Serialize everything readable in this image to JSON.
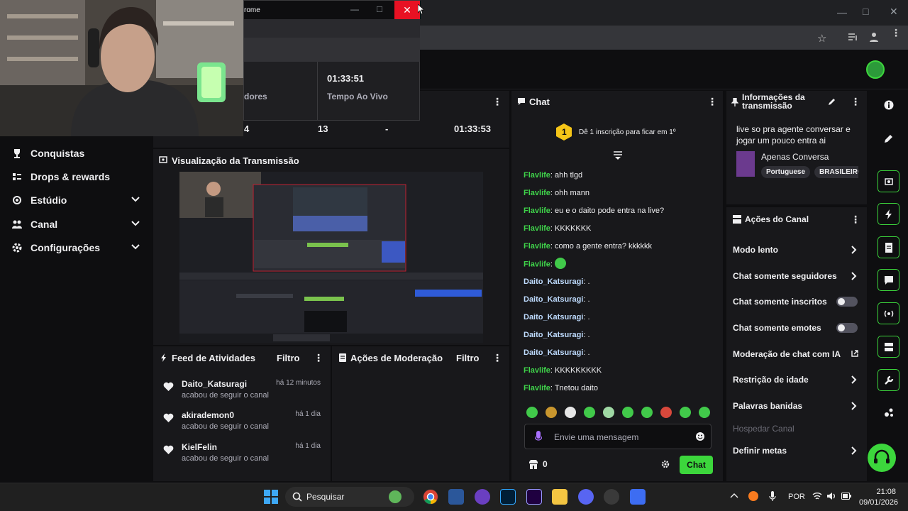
{
  "window": {
    "title_fragment": "rome"
  },
  "popup": {
    "time_value": "01:33:51",
    "time_label": "Tempo Ao Vivo",
    "left_label": "dores"
  },
  "stats": {
    "values": [
      "4",
      "13",
      "-",
      "01:33:53"
    ]
  },
  "nav": {
    "items": [
      {
        "label": "Conquistas",
        "icon": "trophy-icon",
        "chevron": false
      },
      {
        "label": "Drops & rewards",
        "icon": "drops-icon",
        "chevron": false
      },
      {
        "label": "Estúdio",
        "icon": "studio-icon",
        "chevron": true
      },
      {
        "label": "Canal",
        "icon": "channel-icon",
        "chevron": true
      },
      {
        "label": "Configurações",
        "icon": "gear-icon",
        "chevron": true
      }
    ]
  },
  "preview": {
    "title": "Visualização da Transmissão"
  },
  "feed": {
    "title": "Feed de Atividades",
    "filter": "Filtro",
    "items": [
      {
        "name": "Daito_Katsuragi",
        "sub": "acabou de seguir o canal",
        "time": "há 12 minutos"
      },
      {
        "name": "akirademon0",
        "sub": "acabou de seguir o canal",
        "time": "há 1 dia"
      },
      {
        "name": "KielFelin",
        "sub": "acabou de seguir o canal",
        "time": "há 1 dia"
      }
    ]
  },
  "moderation": {
    "title": "Ações de Moderação",
    "filter": "Filtro"
  },
  "chat": {
    "title": "Chat",
    "goal_number": "1",
    "goal_text": "Dê 1 inscrição para ficar em 1º",
    "messages": [
      {
        "user": "Flavlife",
        "text": "ahh tlgd",
        "color": "green"
      },
      {
        "user": "Flavlife",
        "text": "ohh mann",
        "color": "green"
      },
      {
        "user": "Flavlife",
        "text": "eu e o daito pode entra na live?",
        "color": "green"
      },
      {
        "user": "Flavlife",
        "text": "KKKKKKK",
        "color": "green"
      },
      {
        "user": "Flavlife",
        "text": "como a gente entra? kkkkkk",
        "color": "green"
      },
      {
        "user": "Flavlife",
        "text": "",
        "color": "green",
        "emote": true
      },
      {
        "user": "Daito_Katsuragi",
        "text": ".",
        "color": "blue"
      },
      {
        "user": "Daito_Katsuragi",
        "text": ".",
        "color": "blue"
      },
      {
        "user": "Daito_Katsuragi",
        "text": ".",
        "color": "blue"
      },
      {
        "user": "Daito_Katsuragi",
        "text": ".",
        "color": "blue"
      },
      {
        "user": "Daito_Katsuragi",
        "text": ".",
        "color": "blue"
      },
      {
        "user": "Flavlife",
        "text": "KKKKKKKKK",
        "color": "green"
      },
      {
        "user": "Flavlife",
        "text": "Tnetou daito",
        "color": "green"
      }
    ],
    "input_placeholder": "Envie uma mensagem",
    "points": "0",
    "send_label": "Chat"
  },
  "info": {
    "title": "Informações da transmissão",
    "stream_title": "live so pra agente conversar e jogar um pouco entra ai",
    "category": "Apenas Conversa",
    "tags": [
      "Portuguese",
      "BRASILEIRO"
    ]
  },
  "actions": {
    "title": "Ações do Canal",
    "items": [
      {
        "label": "Modo lento",
        "type": "chevron"
      },
      {
        "label": "Chat somente seguidores",
        "type": "chevron"
      },
      {
        "label": "Chat somente inscritos",
        "type": "toggle"
      },
      {
        "label": "Chat somente emotes",
        "type": "toggle"
      },
      {
        "label": "Moderação de chat com IA",
        "type": "external"
      },
      {
        "label": "Restrição de idade",
        "type": "chevron"
      },
      {
        "label": "Palavras banidas",
        "type": "chevron"
      },
      {
        "label": "Hospedar Canal",
        "type": "disabled"
      },
      {
        "label": "Definir metas",
        "type": "chevron"
      }
    ]
  },
  "taskbar": {
    "search_label": "Pesquisar",
    "language": "POR",
    "time": "21:08",
    "date": "09/01/2026"
  },
  "colors": {
    "accent": "#3cd63c",
    "panel": "#18181b",
    "background": "#0e0e10"
  }
}
